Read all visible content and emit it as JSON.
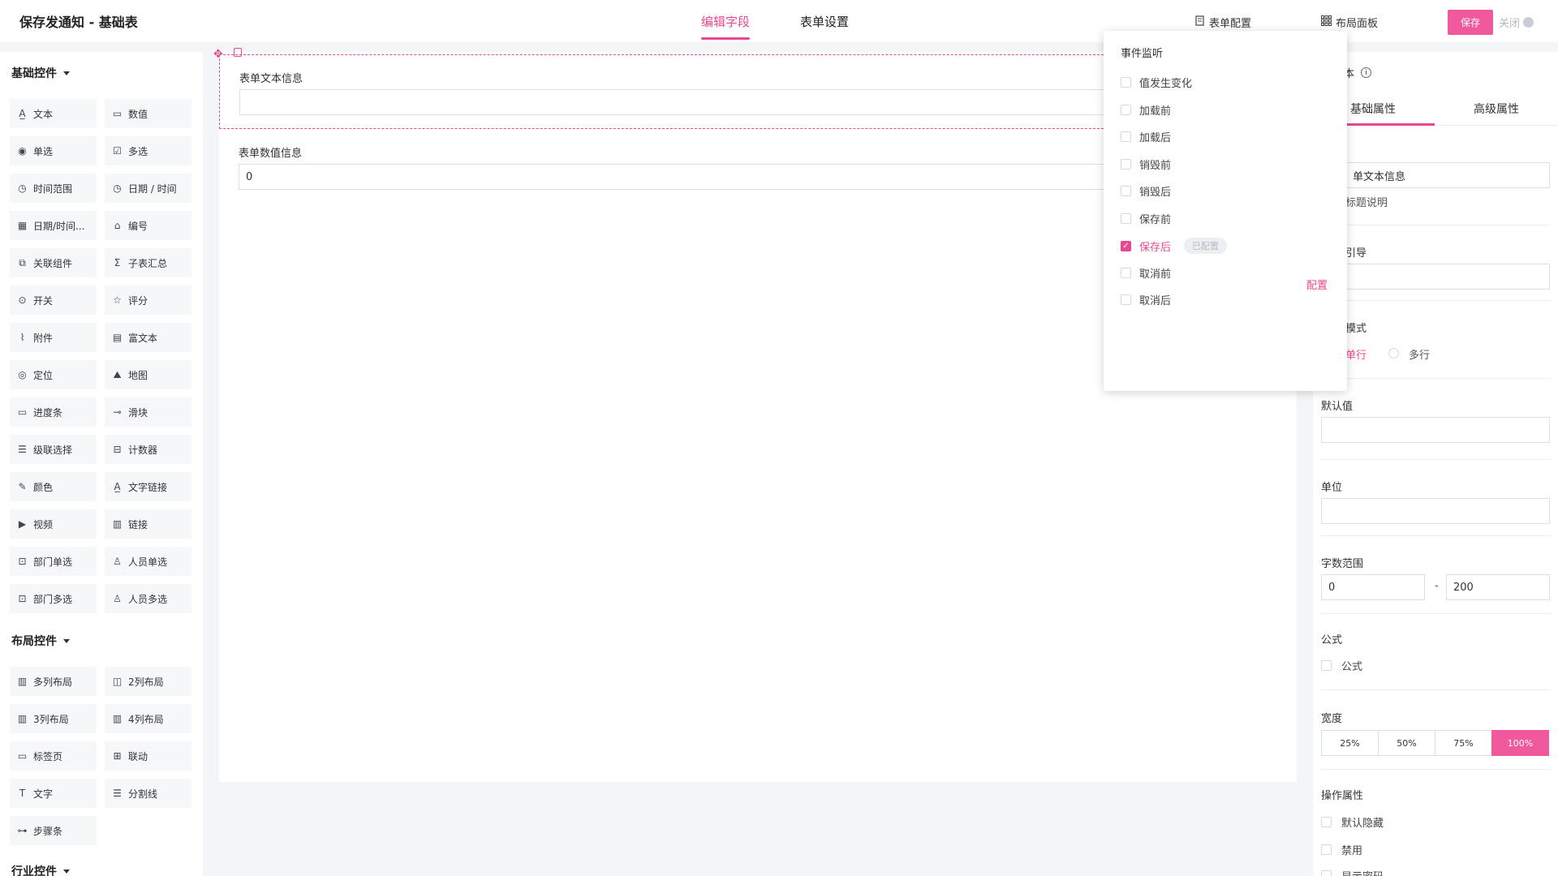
{
  "header": {
    "title": "保存发通知 - 基础表",
    "tabs": [
      {
        "label": "编辑字段"
      },
      {
        "label": "表单设置"
      }
    ],
    "form_config_label": "表单配置",
    "layout_panel_label": "布局面板",
    "save_label": "保存",
    "close_label": "关闭"
  },
  "sidebar": {
    "basic_title": "基础控件",
    "basic": [
      {
        "label": "文本",
        "icon": "text-icon"
      },
      {
        "label": "数值",
        "icon": "number-icon"
      },
      {
        "label": "单选",
        "icon": "radio-icon"
      },
      {
        "label": "多选",
        "icon": "checkbox-icon"
      },
      {
        "label": "时间范围",
        "icon": "clock-icon"
      },
      {
        "label": "日期 / 时间",
        "icon": "clock-icon"
      },
      {
        "label": "日期/时间...",
        "icon": "calendar-icon"
      },
      {
        "label": "编号",
        "icon": "tag-icon"
      },
      {
        "label": "关联组件",
        "icon": "link-box-icon"
      },
      {
        "label": "子表汇总",
        "icon": "sigma-icon"
      },
      {
        "label": "开关",
        "icon": "toggle-icon"
      },
      {
        "label": "评分",
        "icon": "star-icon"
      },
      {
        "label": "附件",
        "icon": "paperclip-icon"
      },
      {
        "label": "富文本",
        "icon": "richtext-icon"
      },
      {
        "label": "定位",
        "icon": "location-icon"
      },
      {
        "label": "地图",
        "icon": "map-icon"
      },
      {
        "label": "进度条",
        "icon": "progress-icon"
      },
      {
        "label": "滑块",
        "icon": "slider-icon"
      },
      {
        "label": "级联选择",
        "icon": "cascade-icon"
      },
      {
        "label": "计数器",
        "icon": "counter-icon"
      },
      {
        "label": "颜色",
        "icon": "dropper-icon"
      },
      {
        "label": "文字链接",
        "icon": "text-link-icon"
      },
      {
        "label": "视频",
        "icon": "video-icon"
      },
      {
        "label": "链接",
        "icon": "link-icon"
      },
      {
        "label": "部门单选",
        "icon": "department-icon"
      },
      {
        "label": "人员单选",
        "icon": "user-icon"
      },
      {
        "label": "部门多选",
        "icon": "department-multi-icon"
      },
      {
        "label": "人员多选",
        "icon": "users-icon"
      }
    ],
    "layout_title": "布局控件",
    "layout": [
      {
        "label": "多列布局",
        "icon": "columns-icon"
      },
      {
        "label": "2列布局",
        "icon": "two-columns-icon"
      },
      {
        "label": "3列布局",
        "icon": "three-columns-icon"
      },
      {
        "label": "4列布局",
        "icon": "four-columns-icon"
      },
      {
        "label": "标签页",
        "icon": "tabs-icon"
      },
      {
        "label": "联动",
        "icon": "grid-icon"
      },
      {
        "label": "文字",
        "icon": "type-icon"
      },
      {
        "label": "分割线",
        "icon": "divider-icon"
      },
      {
        "label": "步骤条",
        "icon": "steps-icon"
      }
    ],
    "industry_title": "行业控件"
  },
  "canvas": {
    "field1_label": "表单文本信息",
    "field1_value": "",
    "field2_label": "表单数值信息",
    "field2_value": "0"
  },
  "events": {
    "title": "事件监听",
    "items": [
      {
        "label": "值发生变化",
        "checked": false
      },
      {
        "label": "加载前",
        "checked": false
      },
      {
        "label": "加载后",
        "checked": false
      },
      {
        "label": "销毁前",
        "checked": false
      },
      {
        "label": "销毁后",
        "checked": false
      },
      {
        "label": "保存前",
        "checked": false
      },
      {
        "label": "保存后",
        "checked": true,
        "badge": "已配置"
      },
      {
        "label": "取消前",
        "checked": false
      },
      {
        "label": "取消后",
        "checked": false
      }
    ],
    "config_label": "配置"
  },
  "props": {
    "title_partial": "本",
    "tabs": [
      "基础属性",
      "高级属性"
    ],
    "title_value_partial": "单文本信息",
    "title_desc_partial": "标题说明",
    "guide_partial": "引导",
    "mode_partial": "模式",
    "single_line_partial": "单行",
    "multi_line": "多行",
    "default_value_label": "默认值",
    "unit_label": "单位",
    "char_range_label": "字数范围",
    "range_min": "0",
    "range_sep": "-",
    "range_max": "200",
    "formula_label": "公式",
    "formula_checkbox": "公式",
    "width_label": "宽度",
    "widths": [
      {
        "label": "25%"
      },
      {
        "label": "50%"
      },
      {
        "label": "75%"
      },
      {
        "label": "100%",
        "active": true
      }
    ],
    "ops_label": "操作属性",
    "ops": [
      "默认隐藏",
      "禁用",
      "显示密码"
    ]
  },
  "colors": {
    "accent": "#e6498f",
    "save": "#f05a9c"
  }
}
